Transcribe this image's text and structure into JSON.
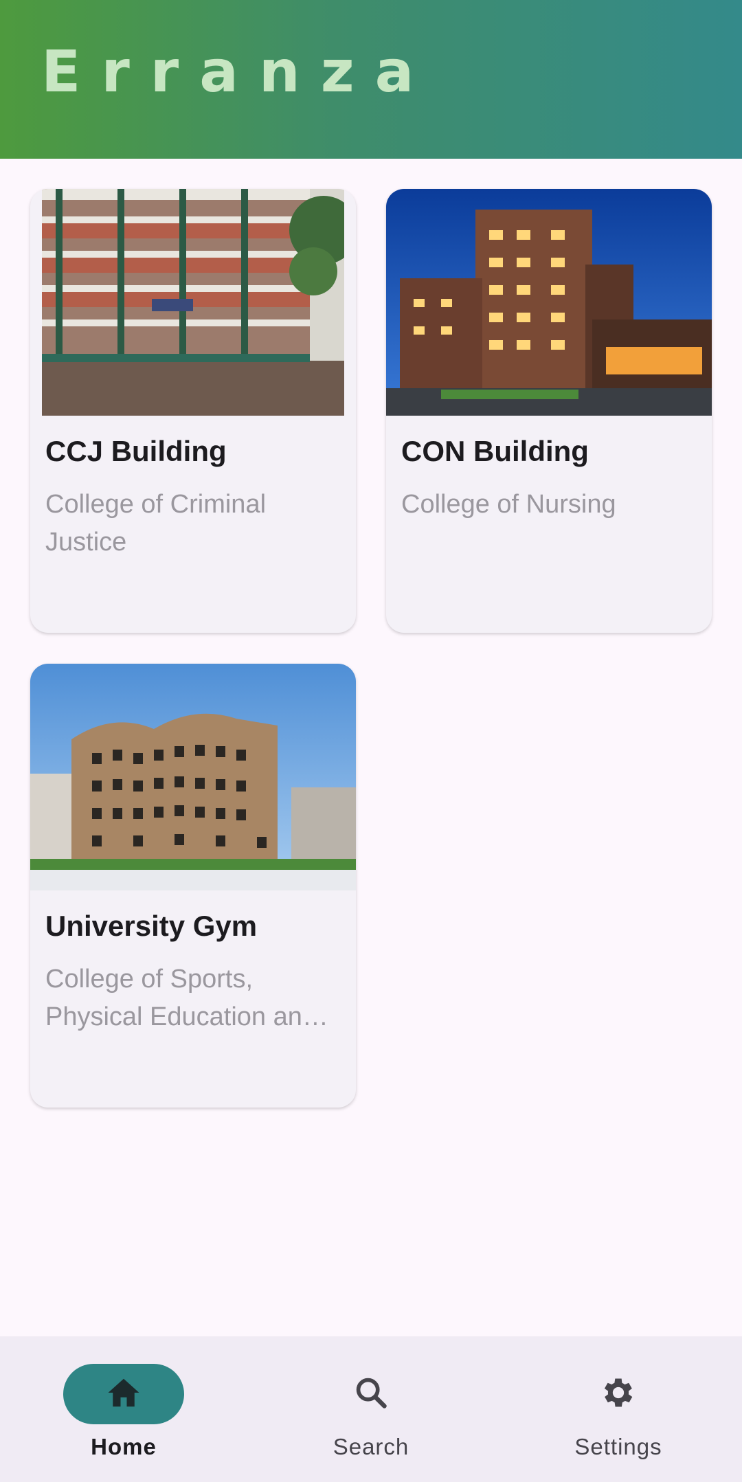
{
  "app": {
    "title": "Erranza"
  },
  "colors": {
    "header_gradient_start": "#4e9a3e",
    "header_gradient_end": "#348a8a",
    "accent": "#2e8585",
    "background": "#fdf7fd",
    "card": "#f4f1f7"
  },
  "buildings": [
    {
      "name": "CCJ Building",
      "college": "College of Criminal Justice",
      "image": "building-photo"
    },
    {
      "name": "CON Building",
      "college": "College of Nursing",
      "image": "building-photo"
    },
    {
      "name": "University Gym",
      "college": "College of Sports, Physical Education and Recreation",
      "image": "building-photo"
    }
  ],
  "bottom_nav": {
    "items": [
      {
        "label": "Home",
        "icon": "home-icon",
        "active": true
      },
      {
        "label": "Search",
        "icon": "search-icon",
        "active": false
      },
      {
        "label": "Settings",
        "icon": "gear-icon",
        "active": false
      }
    ]
  }
}
